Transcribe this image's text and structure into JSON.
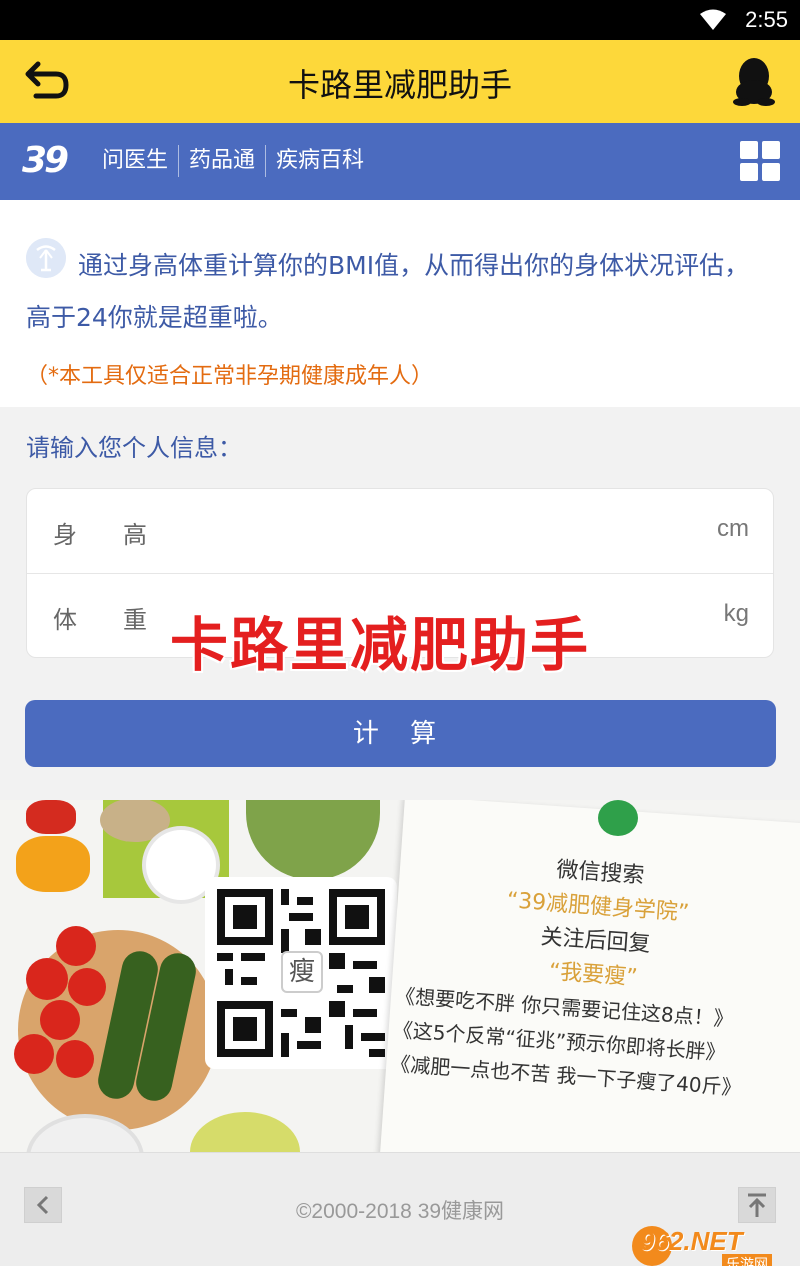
{
  "status_bar": {
    "time": "2:55"
  },
  "title_bar": {
    "title": "卡路里减肥助手"
  },
  "nav": {
    "logo": "39",
    "links": [
      "问医生",
      "药品通",
      "疾病百科"
    ]
  },
  "intro": {
    "description": "通过身高体重计算你的BMI值，从而得出你的身体状况评估，高于24你就是超重啦。",
    "note": "（*本工具仅适合正常非孕期健康成年人）"
  },
  "form": {
    "label": "请输入您个人信息：",
    "height": {
      "label": "身高",
      "unit": "cm",
      "value": ""
    },
    "weight": {
      "label": "体重",
      "unit": "kg",
      "value": ""
    },
    "calculate_label": "计 算"
  },
  "watermark": "卡路里减肥助手",
  "banner": {
    "qr_char": "瘦",
    "lines": {
      "l1": "微信搜索",
      "l2": "“39减肥健身学院”",
      "l3": "关注后回复",
      "l4": "“我要瘦”",
      "l5": "《想要吃不胖 你只需要记住这8点！》",
      "l6": "《这5个反常“征兆”预示你即将长胖》",
      "l7": "《减肥一点也不苦 我一下子瘦了40斤》"
    }
  },
  "footer": {
    "copyright": "©2000-2018 39健康网",
    "badge_main": "962.NET",
    "badge_sub": "乐游网"
  },
  "colors": {
    "title_bar": "#fdd83a",
    "nav": "#4b6bbf",
    "accent_text": "#3d5aa6",
    "note": "#e36b10"
  }
}
